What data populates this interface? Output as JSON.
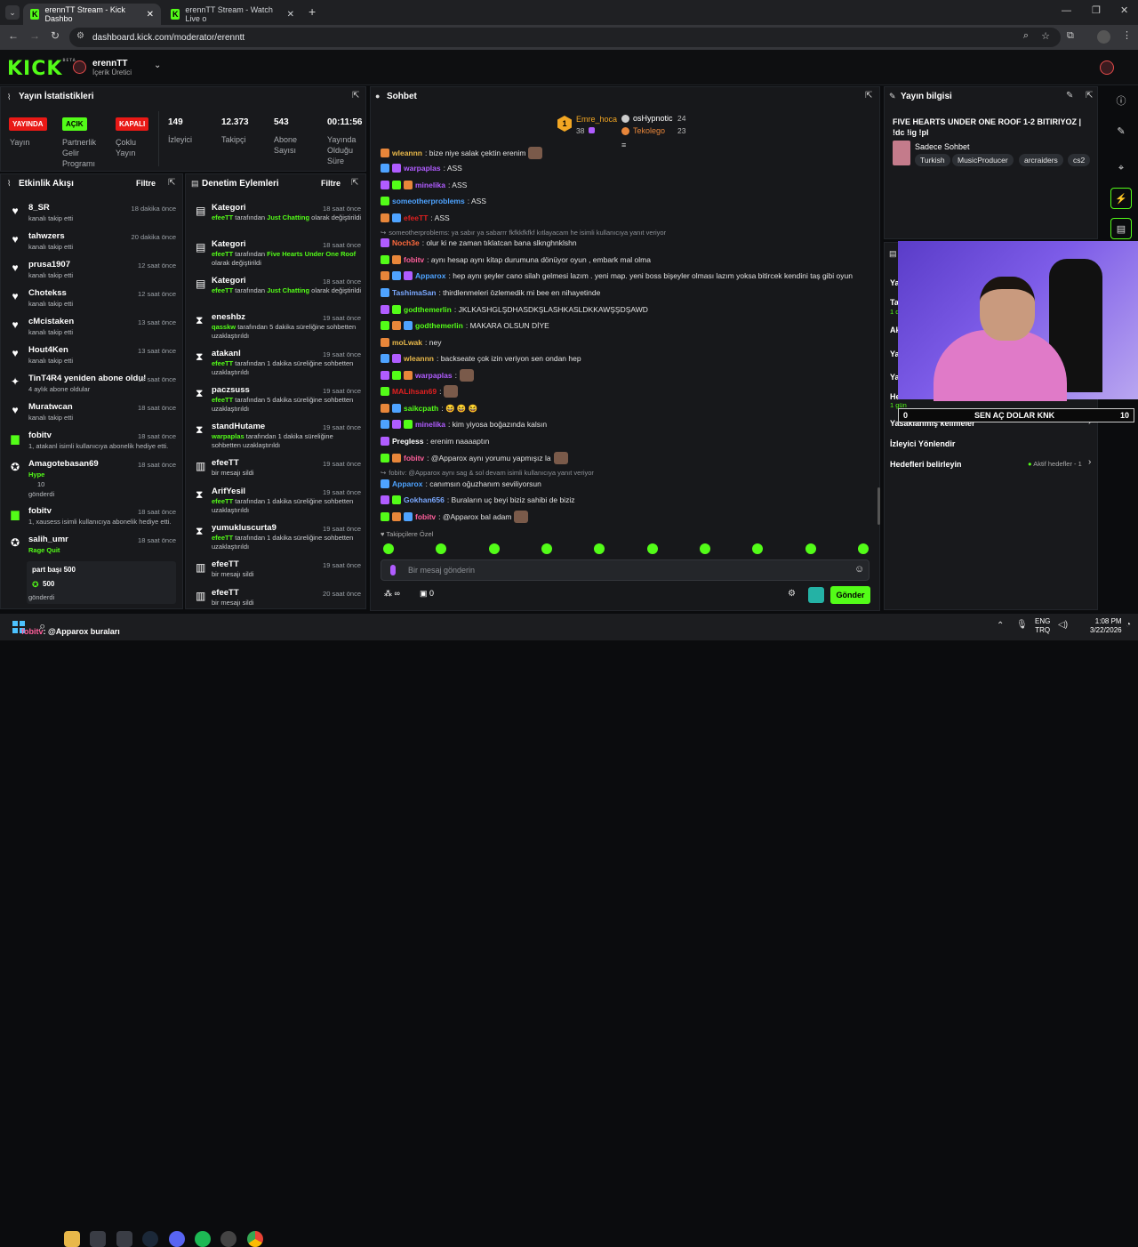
{
  "browser": {
    "tabs": [
      {
        "label": "erennTT Stream - Kick Dashbo"
      },
      {
        "label": "erennTT Stream - Watch Live o"
      }
    ],
    "url": "dashboard.kick.com/moderator/erenntt"
  },
  "header": {
    "logo": "KICK",
    "logo_badge": "BETA",
    "channel_name": "erennTT",
    "channel_role": "İçerik Üretici"
  },
  "stats": {
    "title": "Yayın İstatistikleri",
    "items": [
      {
        "badge": "YAYINDA",
        "label": "Yayın",
        "color": "#e91916"
      },
      {
        "badge": "AÇIK",
        "label": "Partnerlik Gelir Programı",
        "color": "#53fc18"
      },
      {
        "badge": "KAPALI",
        "label": "Çoklu Yayın",
        "color": "#e91916"
      },
      {
        "value": "149",
        "label": "İzleyici"
      },
      {
        "value": "12.373",
        "label": "Takipçi"
      },
      {
        "value": "543",
        "label": "Abone Sayısı"
      },
      {
        "value": "00:11:56",
        "label": "Yayında Olduğu Süre"
      }
    ]
  },
  "activity": {
    "title": "Etkinlik Akışı",
    "filter": "Filtre",
    "items": [
      {
        "name": "8_SR",
        "sub": "kanalı takip etti",
        "time": "18 dakika önce",
        "icon": "heart"
      },
      {
        "name": "tahwzers",
        "sub": "kanalı takip etti",
        "time": "20 dakika önce",
        "icon": "heart"
      },
      {
        "name": "prusa1907",
        "sub": "kanalı takip etti",
        "time": "12 saat önce",
        "icon": "heart"
      },
      {
        "name": "Chotekss",
        "sub": "kanalı takip etti",
        "time": "12 saat önce",
        "icon": "heart"
      },
      {
        "name": "cMcistaken",
        "sub": "kanalı takip etti",
        "time": "13 saat önce",
        "icon": "heart"
      },
      {
        "name": "Hout4Ken",
        "sub": "kanalı takip etti",
        "time": "13 saat önce",
        "icon": "heart"
      },
      {
        "name": "TinT4R4 yeniden abone oldu!",
        "sub": "4 aylık abone oldular",
        "time": "17 saat önce",
        "icon": "star"
      },
      {
        "name": "Muratwcan",
        "sub": "kanalı takip etti",
        "time": "18 saat önce",
        "icon": "heart"
      },
      {
        "name": "fobitv",
        "sub": "1, atakanl isimli kullanıcıya abonelik hediye etti.",
        "time": "18 saat önce",
        "icon": "gift"
      },
      {
        "name": "Amagotebasan69",
        "sub": "Hype",
        "sub2": "10",
        "sub3": "gönderdi",
        "time": "18 saat önce",
        "icon": "kicks"
      },
      {
        "name": "fobitv",
        "sub": "1, xausess isimli kullanıcıya abonelik hediye etti.",
        "time": "18 saat önce",
        "icon": "gift"
      },
      {
        "name": "salih_umr",
        "sub": "Rage Quit",
        "time": "18 saat önce",
        "icon": "kicks"
      }
    ],
    "bottom": {
      "title": "part başı 500",
      "amount": "500",
      "sent": "gönderdi"
    }
  },
  "moderation": {
    "title": "Denetim Eylemleri",
    "filter": "Filtre",
    "items": [
      {
        "name": "Kategori",
        "time": "18 saat önce",
        "actor": "efeeTT",
        "text": "tarafından",
        "hl": "Just Chatting",
        "tail": "olarak değiştirildi",
        "icon": "doc"
      },
      {
        "name": "Kategori",
        "time": "18 saat önce",
        "actor": "efeeTT",
        "text": "tarafından",
        "hl": "Five Hearts Under One Roof",
        "tail": "olarak değiştirildi",
        "icon": "doc"
      },
      {
        "name": "Kategori",
        "time": "18 saat önce",
        "actor": "efeeTT",
        "text": "tarafından",
        "hl": "Just Chatting",
        "tail": "olarak değiştirildi",
        "icon": "doc"
      },
      {
        "name": "eneshbz",
        "time": "19 saat önce",
        "actor": "qasskw",
        "text": "tarafından 5 dakika süreliğine sohbetten uzaklaştırıldı",
        "icon": "hourglass"
      },
      {
        "name": "atakanl",
        "time": "19 saat önce",
        "actor": "efeeTT",
        "text": "tarafından 1 dakika süreliğine sohbetten uzaklaştırıldı",
        "icon": "hourglass"
      },
      {
        "name": "paczsuss",
        "time": "19 saat önce",
        "actor": "efeeTT",
        "text": "tarafından 5 dakika süreliğine sohbetten uzaklaştırıldı",
        "icon": "hourglass"
      },
      {
        "name": "standHutame",
        "time": "19 saat önce",
        "actor": "warpaplas",
        "text": "tarafından 1 dakika süreliğine sohbetten uzaklaştırıldı",
        "icon": "hourglass"
      },
      {
        "name": "efeeTT",
        "time": "19 saat önce",
        "text": "bir mesajı sildi",
        "icon": "trash"
      },
      {
        "name": "ArifYesil",
        "time": "19 saat önce",
        "actor": "efeeTT",
        "text": "tarafından 1 dakika süreliğine sohbetten uzaklaştırıldı",
        "icon": "hourglass"
      },
      {
        "name": "yumukluscurta9",
        "time": "19 saat önce",
        "actor": "efeeTT",
        "text": "tarafından 1 dakika süreliğine sohbetten uzaklaştırıldı",
        "icon": "hourglass"
      },
      {
        "name": "efeeTT",
        "time": "19 saat önce",
        "text": "bir mesajı sildi",
        "icon": "trash"
      },
      {
        "name": "efeeTT",
        "time": "20 saat önce",
        "text": "bir mesajı sildi",
        "icon": "trash"
      }
    ]
  },
  "chat": {
    "title": "Sohbet",
    "leaders": [
      {
        "name": "Emre_hoca",
        "count": "38"
      },
      {
        "name": "osHypnotic",
        "count": "24"
      },
      {
        "name": "Tekolego",
        "count": "23"
      }
    ],
    "messages": [
      {
        "user": "wleannn",
        "color": "#e8b84a",
        "text": ": bize niye salak çektin erenim"
      },
      {
        "user": "warpaplas",
        "color": "#b05cff",
        "text": ": ASS"
      },
      {
        "user": "minelika",
        "color": "#b05cff",
        "text": ": ASS"
      },
      {
        "user": "someotherproblems",
        "color": "#4ea3ff",
        "text": ": ASS"
      },
      {
        "user": "efeeTT",
        "color": "#e02020",
        "text": ": ASS"
      },
      {
        "reply": "someotherproblems: ya sabır ya sabarrr fkfkkfkfkf kıtlayacam he isimli kullanıcıya yanıt veriyor"
      },
      {
        "user": "Noch3e",
        "color": "#ff6a3d",
        "text": ": olur ki ne zaman tıklatcan bana slknghnklshn"
      },
      {
        "user": "fobitv",
        "color": "#ff5f9b",
        "text": ": aynı hesap aynı kitap durumuna dönüyor oyun , embark mal olma"
      },
      {
        "user": "Apparox",
        "color": "#4ea3ff",
        "text": ": hep aynı şeyler cano silah gelmesi lazım . yeni map. yeni boss bişeyler olması lazım yoksa bitircek kendini taş gibi oyun"
      },
      {
        "user": "TashimaSan",
        "color": "#7aa8ff",
        "text": ": thirdlenmeleri özlemedik mi bee en nihayetinde"
      },
      {
        "user": "godthemerlin",
        "color": "#53fc18",
        "text": ": JKLKASHGLŞDHASDKŞLASHKASLDKKAWŞŞDŞAWD"
      },
      {
        "user": "godthemerlin",
        "color": "#53fc18",
        "text": ": MAKARA OLSUN DİYE"
      },
      {
        "user": "moLwak",
        "color": "#e8b84a",
        "text": ": ney"
      },
      {
        "user": "wleannn",
        "color": "#e8b84a",
        "text": ": backseate çok izin veriyon sen ondan hep"
      },
      {
        "user": "warpaplas",
        "color": "#b05cff",
        "text": ":"
      },
      {
        "user": "MALihsan69",
        "color": "#e02020",
        "text": ":"
      },
      {
        "user": "saikcpath",
        "color": "#53fc18",
        "text": ": 😆 😆 😆"
      },
      {
        "user": "minelika",
        "color": "#b05cff",
        "text": ": kim yiyosa boğazında kalsın"
      },
      {
        "user": "Pregless",
        "color": "#ffffff",
        "text": ": erenim naaaaptın"
      },
      {
        "user": "fobitv",
        "color": "#ff5f9b",
        "text": ": @Apparox aynı yorumu yapmışız la"
      },
      {
        "reply": "fobitv: @Apparox aynı sag & sol devam  isimli kullanıcıya yanıt veriyor"
      },
      {
        "user": "Apparox",
        "color": "#4ea3ff",
        "text": ": canımsın oğuzhanım seviliyorsun"
      },
      {
        "user": "Gokhan656",
        "color": "#7aa8ff",
        "text": ": Buraların uç beyi biziz sahibi de biziz"
      },
      {
        "user": "fobitv",
        "color": "#ff5f9b",
        "text": ": @Apparox bal adam"
      }
    ],
    "followers_only": "Takipçilere Özel",
    "input_placeholder": "Bir mesaj gönderin",
    "send": "Gönder",
    "infinity": "∞",
    "gift_count": "0"
  },
  "stream_info": {
    "title": "Yayın bilgisi",
    "stream_title": "FIVE HEARTS UNDER ONE ROOF 1-2 BITIRIYOZ | !dc !ig !pl",
    "category": "Sadece Sohbet",
    "tags": [
      "Turkish",
      "MusicProducer",
      "arcraiders",
      "cs2"
    ]
  },
  "side_menu": {
    "items": [
      "Yasaklanmış kelimeler",
      "İzleyici Yönlendir",
      "Hedefleri belirleyin"
    ],
    "goal_status": "Aktif hedefler - 1",
    "partial_labels": [
      "Ya",
      "Ta",
      "1 dk",
      "Ak",
      "Ya",
      "Ya",
      "He",
      "1 gün"
    ]
  },
  "overlay": {
    "left": "0",
    "text": "SEN AÇ DOLAR KNK",
    "right": "10"
  },
  "taskbar": {
    "ticker_user": "fobitv",
    "ticker_text": ": @Apparox buraları",
    "lang": "ENG",
    "lang2": "TRQ",
    "time": "1:08 PM",
    "date": "3/22/2026"
  }
}
